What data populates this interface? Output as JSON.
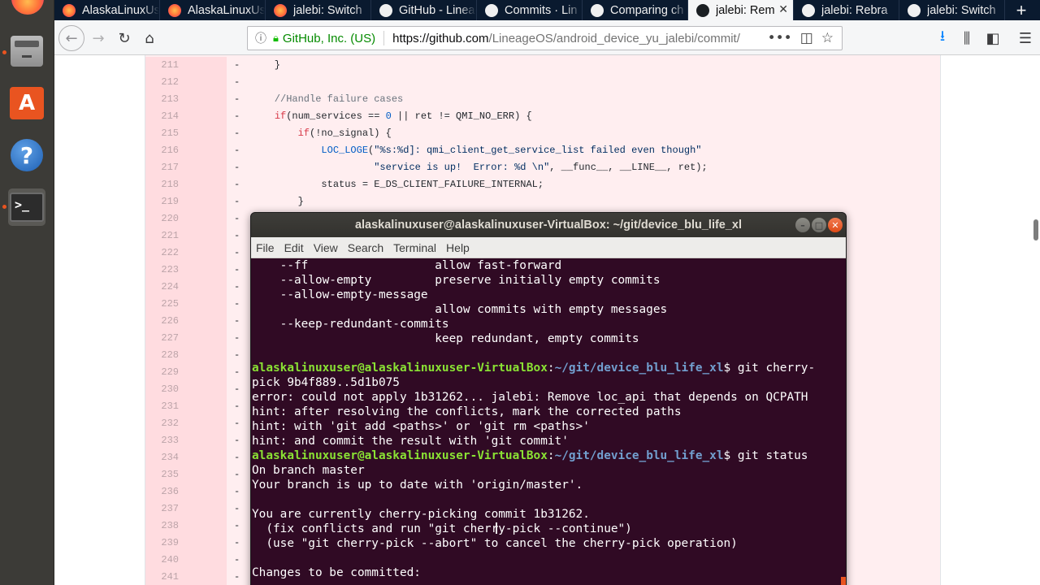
{
  "browser": {
    "tabs": [
      {
        "label": "AlaskaLinuxUs",
        "icon": "firefox-icon",
        "active": false
      },
      {
        "label": "AlaskaLinuxUs",
        "icon": "firefox-icon",
        "active": false
      },
      {
        "label": "jalebi: Switch",
        "icon": "firefox-icon",
        "active": false
      },
      {
        "label": "GitHub - Lineag",
        "icon": "github-icon",
        "active": false
      },
      {
        "label": "Commits · Lin",
        "icon": "github-icon",
        "active": false
      },
      {
        "label": "Comparing ch",
        "icon": "github-icon",
        "active": false
      },
      {
        "label": "jalebi: Rem",
        "icon": "github-icon",
        "active": true
      },
      {
        "label": "jalebi: Rebra",
        "icon": "github-icon",
        "active": false
      },
      {
        "label": "jalebi: Switch",
        "icon": "github-icon",
        "active": false
      }
    ],
    "new_tab": "+",
    "tab_close": "✕",
    "site_identity": "GitHub, Inc. (US)",
    "url_host": "https://github.com",
    "url_path": "/LineageOS/android_device_yu_jalebi/commit/",
    "page_actions": "•••"
  },
  "diff": {
    "lines": [
      {
        "n": "211",
        "m": "-",
        "code": [
          {
            "t": "    }",
            "c": ""
          }
        ]
      },
      {
        "n": "212",
        "m": "-",
        "code": []
      },
      {
        "n": "213",
        "m": "-",
        "code": [
          {
            "t": "    //Handle failure cases",
            "c": "cm"
          }
        ]
      },
      {
        "n": "214",
        "m": "-",
        "code": [
          {
            "t": "    ",
            "c": ""
          },
          {
            "t": "if",
            "c": "kw"
          },
          {
            "t": "(num_services == ",
            "c": ""
          },
          {
            "t": "0",
            "c": "nm"
          },
          {
            "t": " || ret != QMI_NO_ERR) {",
            "c": ""
          }
        ]
      },
      {
        "n": "215",
        "m": "-",
        "code": [
          {
            "t": "        ",
            "c": ""
          },
          {
            "t": "if",
            "c": "kw"
          },
          {
            "t": "(!no_signal) {",
            "c": ""
          }
        ]
      },
      {
        "n": "216",
        "m": "-",
        "code": [
          {
            "t": "            ",
            "c": ""
          },
          {
            "t": "LOC_LOGE",
            "c": "nm"
          },
          {
            "t": "(",
            "c": ""
          },
          {
            "t": "\"%s:%d]: qmi_client_get_service_list failed even though\"",
            "c": "st"
          }
        ]
      },
      {
        "n": "217",
        "m": "-",
        "code": [
          {
            "t": "                     ",
            "c": ""
          },
          {
            "t": "\"service is up!  Error: %d \\n\"",
            "c": "st"
          },
          {
            "t": ", __func__, __LINE__, ret);",
            "c": ""
          }
        ]
      },
      {
        "n": "218",
        "m": "-",
        "code": [
          {
            "t": "            status = E_DS_CLIENT_FAILURE_INTERNAL;",
            "c": ""
          }
        ]
      },
      {
        "n": "219",
        "m": "-",
        "code": [
          {
            "t": "        }",
            "c": ""
          }
        ]
      },
      {
        "n": "220",
        "m": "-",
        "code": []
      },
      {
        "n": "221",
        "m": "-",
        "code": []
      },
      {
        "n": "222",
        "m": "-",
        "code": []
      },
      {
        "n": "223",
        "m": "-",
        "code": []
      },
      {
        "n": "224",
        "m": "-",
        "code": []
      },
      {
        "n": "225",
        "m": "-",
        "code": []
      },
      {
        "n": "226",
        "m": "-",
        "code": []
      },
      {
        "n": "227",
        "m": "-",
        "code": []
      },
      {
        "n": "228",
        "m": "-",
        "code": []
      },
      {
        "n": "229",
        "m": "-",
        "code": []
      },
      {
        "n": "230",
        "m": "-",
        "code": []
      },
      {
        "n": "231",
        "m": "-",
        "code": []
      },
      {
        "n": "232",
        "m": "-",
        "code": []
      },
      {
        "n": "233",
        "m": "-",
        "code": []
      },
      {
        "n": "234",
        "m": "-",
        "code": []
      },
      {
        "n": "235",
        "m": "-",
        "code": []
      },
      {
        "n": "236",
        "m": "-",
        "code": []
      },
      {
        "n": "237",
        "m": "-",
        "code": []
      },
      {
        "n": "238",
        "m": "-",
        "code": []
      },
      {
        "n": "239",
        "m": "-",
        "code": []
      },
      {
        "n": "240",
        "m": "-",
        "code": []
      },
      {
        "n": "241",
        "m": "-",
        "code": []
      }
    ]
  },
  "terminal": {
    "title": "alaskalinuxuser@alaskalinuxuser-VirtualBox: ~/git/device_blu_life_xl",
    "menu": [
      "File",
      "Edit",
      "View",
      "Search",
      "Terminal",
      "Help"
    ],
    "prompt_user": "alaskalinuxuser@alaskalinuxuser-VirtualBox",
    "prompt_path": "~/git/device_blu_life_xl",
    "lines": [
      {
        "type": "text",
        "text": "    --ff                  allow fast-forward"
      },
      {
        "type": "text",
        "text": "    --allow-empty         preserve initially empty commits"
      },
      {
        "type": "text",
        "text": "    --allow-empty-message"
      },
      {
        "type": "text",
        "text": "                          allow commits with empty messages"
      },
      {
        "type": "text",
        "text": "    --keep-redundant-commits"
      },
      {
        "type": "text",
        "text": "                          keep redundant, empty commits"
      },
      {
        "type": "text",
        "text": ""
      },
      {
        "type": "prompt",
        "text": "$ git cherry-"
      },
      {
        "type": "text",
        "text": "pick 9b4f889..5d1b075"
      },
      {
        "type": "text",
        "text": "error: could not apply 1b31262... jalebi: Remove loc_api that depends on QCPATH"
      },
      {
        "type": "text",
        "text": "hint: after resolving the conflicts, mark the corrected paths"
      },
      {
        "type": "text",
        "text": "hint: with 'git add <paths>' or 'git rm <paths>'"
      },
      {
        "type": "text",
        "text": "hint: and commit the result with 'git commit'"
      },
      {
        "type": "prompt",
        "text": "$ git status"
      },
      {
        "type": "text",
        "text": "On branch master"
      },
      {
        "type": "text",
        "text": "Your branch is up to date with 'origin/master'."
      },
      {
        "type": "text",
        "text": ""
      },
      {
        "type": "text",
        "text": "You are currently cherry-picking commit 1b31262."
      },
      {
        "type": "text",
        "text": "  (fix conflicts and run \"git cherry-pick --continue\")"
      },
      {
        "type": "text",
        "text": "  (use \"git cherry-pick --abort\" to cancel the cherry-pick operation)"
      },
      {
        "type": "text",
        "text": ""
      },
      {
        "type": "text",
        "text": "Changes to be committed:"
      }
    ]
  },
  "colors": {
    "ubuntu_orange": "#e95420",
    "terminal_bg": "#300a24",
    "prompt_green": "#8ae234",
    "prompt_blue": "#729fcf",
    "diff_deleted_bg": "#ffeef0"
  }
}
